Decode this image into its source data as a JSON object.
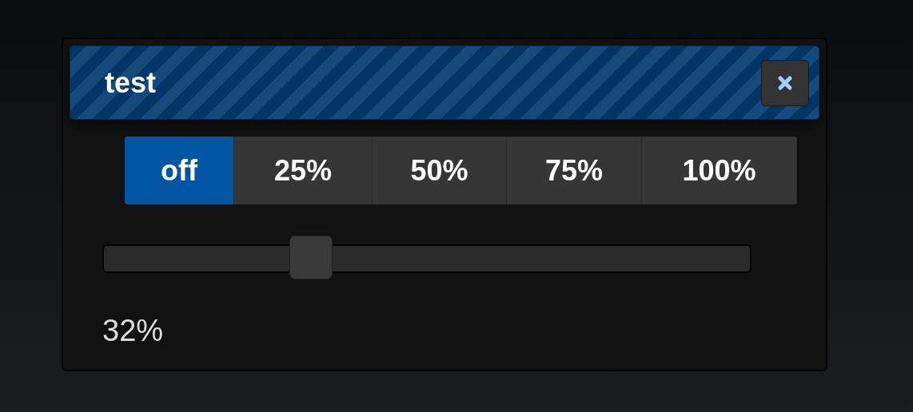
{
  "dialog": {
    "title": "test",
    "options": [
      {
        "label": "off",
        "selected": true
      },
      {
        "label": "25%",
        "selected": false
      },
      {
        "label": "50%",
        "selected": false
      },
      {
        "label": "75%",
        "selected": false
      },
      {
        "label": "100%",
        "selected": false
      }
    ],
    "slider": {
      "level": 0.32
    },
    "reading": "32%"
  }
}
